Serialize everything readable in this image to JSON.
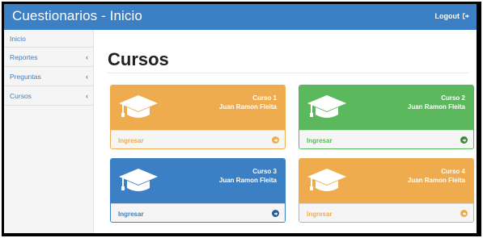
{
  "app": {
    "title": "Cuestionarios - Inicio"
  },
  "header": {
    "logout_label": "Logout",
    "logout_icon": "sign-out-icon"
  },
  "sidebar": {
    "items": [
      {
        "label": "Inicio",
        "has_chevron": false
      },
      {
        "label": "Reportes",
        "has_chevron": true,
        "chevron": "‹"
      },
      {
        "label": "Preguntas",
        "has_chevron": true,
        "chevron": "‹"
      },
      {
        "label": "Cursos",
        "has_chevron": true,
        "chevron": "‹"
      }
    ]
  },
  "main": {
    "title": "Cursos",
    "cards": [
      {
        "name": "Curso 1",
        "teacher": "Juan Ramon Fleita",
        "action": "Ingresar",
        "color": "#efac4e",
        "icon": "graduation-cap-icon"
      },
      {
        "name": "Curso 2",
        "teacher": "Juan Ramon Fleita",
        "action": "Ingresar",
        "color": "#5cb85c",
        "icon": "graduation-cap-icon"
      },
      {
        "name": "Curso 3",
        "teacher": "Juan Ramon Fleita",
        "action": "Ingresar",
        "color": "#3b7fc4",
        "icon": "graduation-cap-icon"
      },
      {
        "name": "Curso 4",
        "teacher": "Juan Ramon Fleita",
        "action": "Ingresar",
        "color": "#efac4e",
        "icon": "graduation-cap-icon"
      }
    ]
  }
}
